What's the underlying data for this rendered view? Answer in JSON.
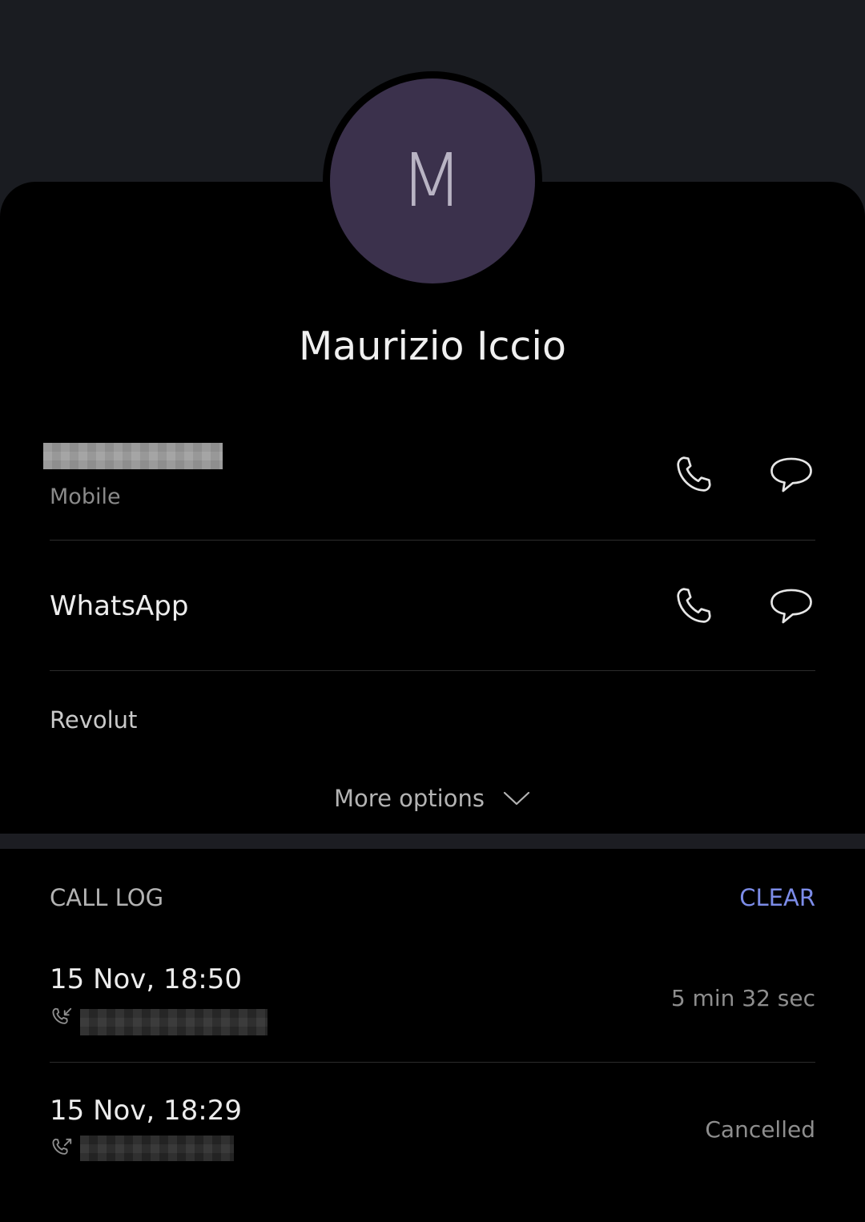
{
  "contact": {
    "avatar_letter": "M",
    "name": "Maurizio Iccio"
  },
  "entries": [
    {
      "label": "Mobile",
      "call_icon": "phone-icon",
      "message_icon": "message-bubble-icon"
    },
    {
      "label": "WhatsApp",
      "call_icon": "phone-icon",
      "message_icon": "message-bubble-icon"
    },
    {
      "label": "Revolut"
    }
  ],
  "more_options": {
    "label": "More options",
    "icon": "chevron-down-icon"
  },
  "call_log": {
    "header": "CALL LOG",
    "clear_label": "CLEAR",
    "items": [
      {
        "time": "15 Nov, 18:50",
        "status": "5 min 32 sec",
        "direction_icon": "incoming-call-icon",
        "number_prefix": "+"
      },
      {
        "time": "15 Nov, 18:29",
        "status": "Cancelled",
        "direction_icon": "outgoing-call-icon"
      }
    ]
  },
  "colors": {
    "background": "#000000",
    "header_background": "#1a1c21",
    "avatar": "#3b314c",
    "accent": "#7c8ce8"
  }
}
